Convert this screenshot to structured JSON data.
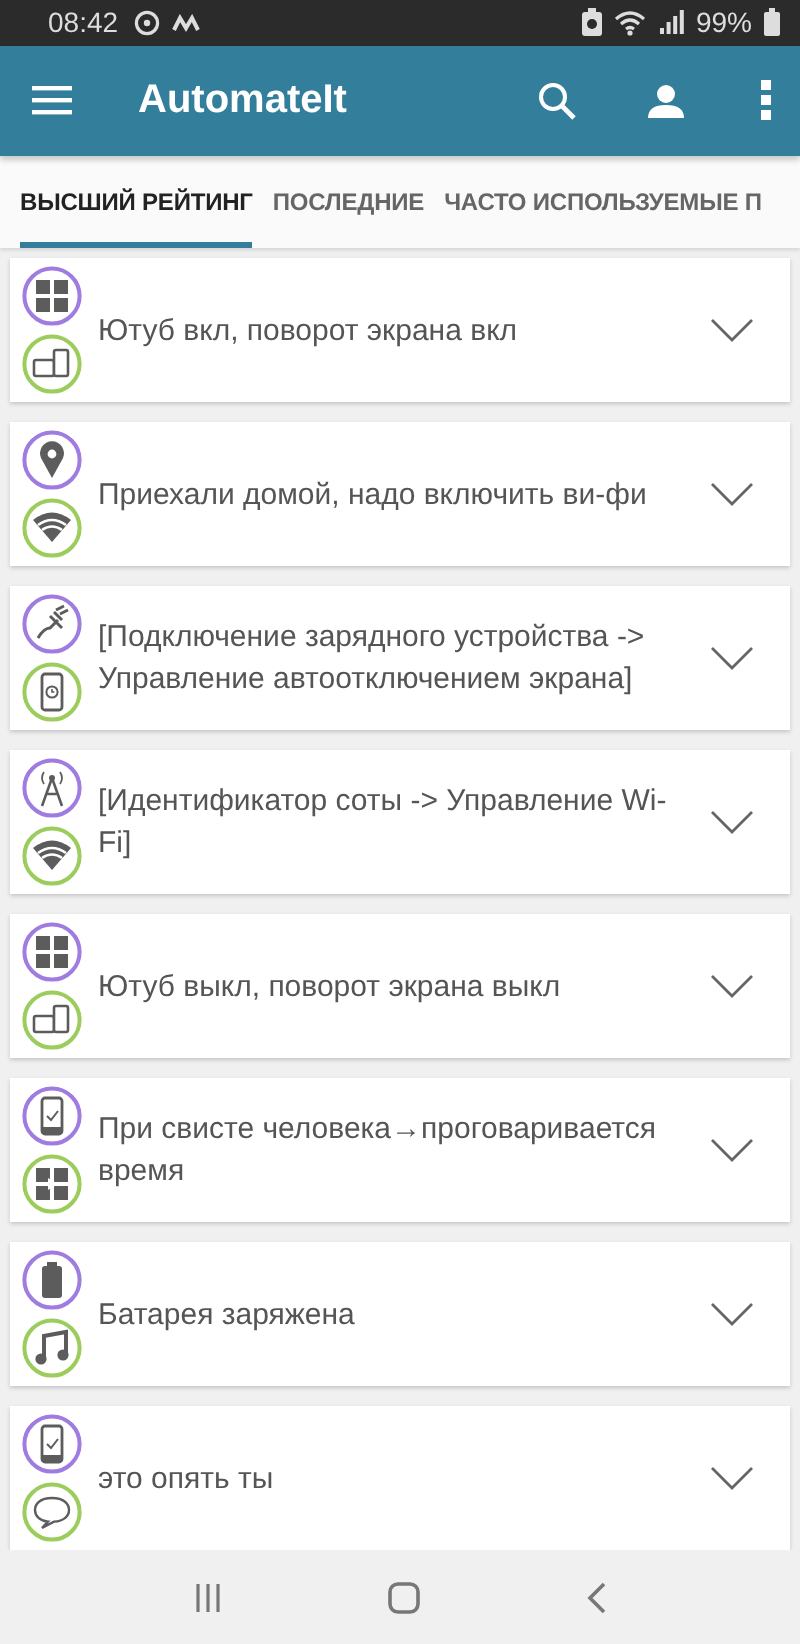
{
  "status_bar": {
    "time": "08:42",
    "battery": "99%"
  },
  "app_bar": {
    "title": "AutomateIt"
  },
  "tabs": [
    {
      "label": "ВЫСШИЙ РЕЙТИНГ",
      "selected": true
    },
    {
      "label": "ПОСЛЕДНИЕ",
      "selected": false
    },
    {
      "label": "ЧАСТО ИСПОЛЬЗУЕМЫЕ П",
      "selected": false
    }
  ],
  "rules": [
    {
      "text": "Ютуб вкл, поворот экрана вкл"
    },
    {
      "text": "Приехали домой, надо включить ви-фи"
    },
    {
      "text": "[Подключение зарядного устройства -> Управление автоотключением экрана]"
    },
    {
      "text": "[Идентификатор соты -> Управление Wi-Fi]"
    },
    {
      "text": "Ютуб выкл, поворот экрана выкл"
    },
    {
      "text": "При свисте человека→проговаривается время"
    },
    {
      "text": "Батарея заряжена"
    },
    {
      "text": "это опять ты"
    }
  ]
}
